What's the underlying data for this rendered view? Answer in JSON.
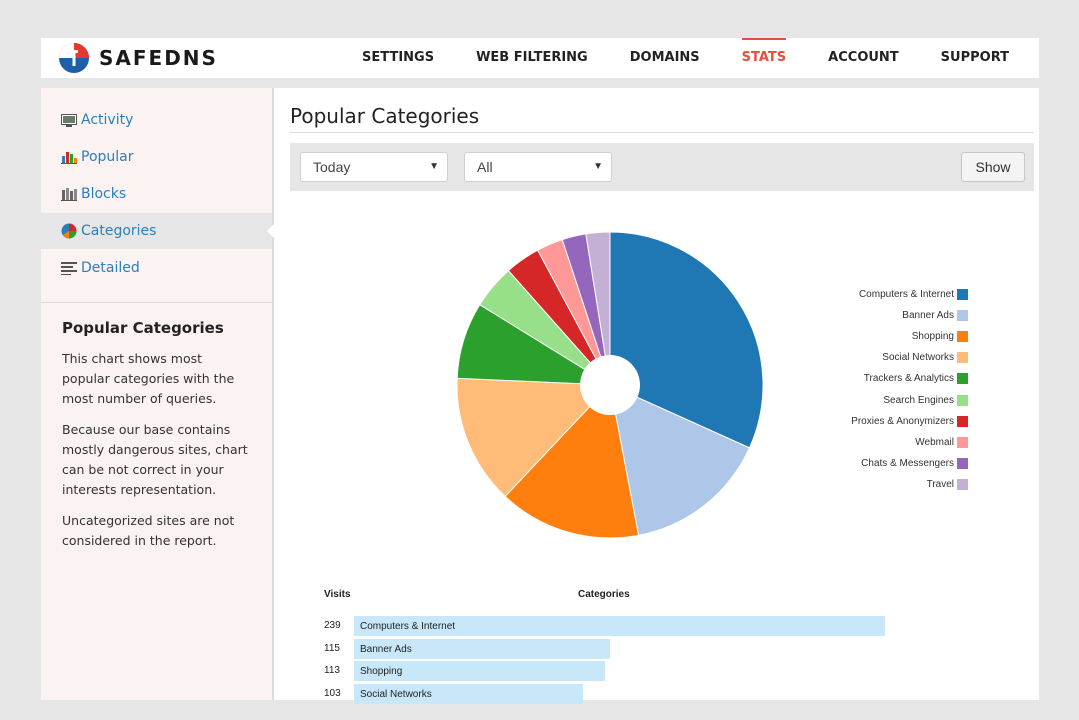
{
  "header": {
    "logo_text": "SAFEDNS",
    "nav": [
      {
        "label": "SETTINGS"
      },
      {
        "label": "WEB FILTERING"
      },
      {
        "label": "DOMAINS"
      },
      {
        "label": "STATS",
        "active": true
      },
      {
        "label": "ACCOUNT"
      },
      {
        "label": "SUPPORT"
      }
    ]
  },
  "sidebar": {
    "items": [
      {
        "label": "Activity",
        "icon": "activity-icon"
      },
      {
        "label": "Popular",
        "icon": "bar-chart-icon"
      },
      {
        "label": "Blocks",
        "icon": "blocks-icon"
      },
      {
        "label": "Categories",
        "icon": "pie-chart-icon",
        "active": true
      },
      {
        "label": "Detailed",
        "icon": "list-icon"
      }
    ],
    "info": {
      "title": "Popular Categories",
      "paragraphs": [
        "This chart shows most popular categories with the most number of queries.",
        "Because our base contains mostly dangerous sites, chart can be not correct in your interests representation.",
        "Uncategorized sites are not considered in the report."
      ]
    }
  },
  "main": {
    "title": "Popular Categories",
    "filters": {
      "period": "Today",
      "scope": "All",
      "show_label": "Show"
    }
  },
  "colors": {
    "accent": "#e74c3c",
    "link": "#2c7fb8",
    "bar": "#c8e8fa"
  },
  "chart_data": [
    {
      "type": "pie",
      "categories": [
        "Computers & Internet",
        "Banner Ads",
        "Shopping",
        "Social Networks",
        "Trackers & Analytics",
        "Search Engines",
        "Proxies & Anonymizers",
        "Webmail",
        "Chats & Messengers",
        "Travel"
      ],
      "values": [
        239,
        115,
        113,
        103,
        61,
        35,
        28,
        21,
        19,
        19
      ],
      "colors": [
        "#1f77b4",
        "#aec7e8",
        "#ff7f0e",
        "#ffbb78",
        "#2ca02c",
        "#98df8a",
        "#d62728",
        "#ff9896",
        "#9467bd",
        "#c5b0d5"
      ],
      "legend": "right"
    },
    {
      "type": "table",
      "columns": [
        "Visits",
        "Categories"
      ],
      "rows": [
        {
          "visits": 239,
          "category": "Computers & Internet"
        },
        {
          "visits": 115,
          "category": "Banner Ads"
        },
        {
          "visits": 113,
          "category": "Shopping"
        },
        {
          "visits": 103,
          "category": "Social Networks"
        }
      ]
    }
  ]
}
